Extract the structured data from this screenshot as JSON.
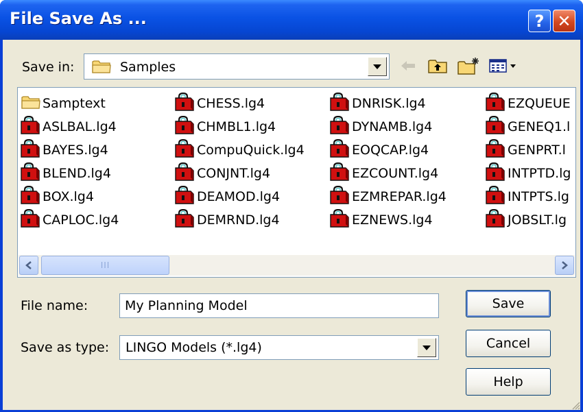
{
  "window": {
    "title": "File Save As ..."
  },
  "title_buttons": {
    "help": "?",
    "close": "✕"
  },
  "save_in": {
    "label": "Save in:",
    "value": "Samples"
  },
  "toolbar": {
    "icons": [
      "back-arrow-icon",
      "up-folder-icon",
      "new-folder-icon",
      "view-menu-icon"
    ]
  },
  "files": [
    {
      "name": "Samptext",
      "type": "folder"
    },
    {
      "name": "ASLBAL.lg4",
      "type": "lingo"
    },
    {
      "name": "BAYES.lg4",
      "type": "lingo"
    },
    {
      "name": "BLEND.lg4",
      "type": "lingo"
    },
    {
      "name": "BOX.lg4",
      "type": "lingo"
    },
    {
      "name": "CAPLOC.lg4",
      "type": "lingo"
    },
    {
      "name": "CHESS.lg4",
      "type": "lingo"
    },
    {
      "name": "CHMBL1.lg4",
      "type": "lingo"
    },
    {
      "name": "CompuQuick.lg4",
      "type": "lingo"
    },
    {
      "name": "CONJNT.lg4",
      "type": "lingo"
    },
    {
      "name": "DEAMOD.lg4",
      "type": "lingo"
    },
    {
      "name": "DEMRND.lg4",
      "type": "lingo"
    },
    {
      "name": "DNRISK.lg4",
      "type": "lingo"
    },
    {
      "name": "DYNAMB.lg4",
      "type": "lingo"
    },
    {
      "name": "EOQCAP.lg4",
      "type": "lingo"
    },
    {
      "name": "EZCOUNT.lg4",
      "type": "lingo"
    },
    {
      "name": "EZMREPAR.lg4",
      "type": "lingo"
    },
    {
      "name": "EZNEWS.lg4",
      "type": "lingo"
    },
    {
      "name": "EZQUEUE",
      "type": "lingo"
    },
    {
      "name": "GENEQ1.l",
      "type": "lingo"
    },
    {
      "name": "GENPRT.l",
      "type": "lingo"
    },
    {
      "name": "INTPTD.lg",
      "type": "lingo"
    },
    {
      "name": "INTPTS.lg",
      "type": "lingo"
    },
    {
      "name": "JOBSLT.lg",
      "type": "lingo"
    }
  ],
  "scrollbar": {
    "thumb_grip": "III"
  },
  "file_name": {
    "label": "File name:",
    "value": "My Planning Model"
  },
  "save_as_type": {
    "label": "Save as type:",
    "value": "LINGO Models (*.lg4)"
  },
  "buttons": {
    "save": "Save",
    "cancel": "Cancel",
    "help": "Help"
  },
  "colors": {
    "titlebar": "#0a52e4",
    "dialog_face": "#ece9d8",
    "close_button": "#d4481f",
    "border_blue": "#7f9db9"
  }
}
